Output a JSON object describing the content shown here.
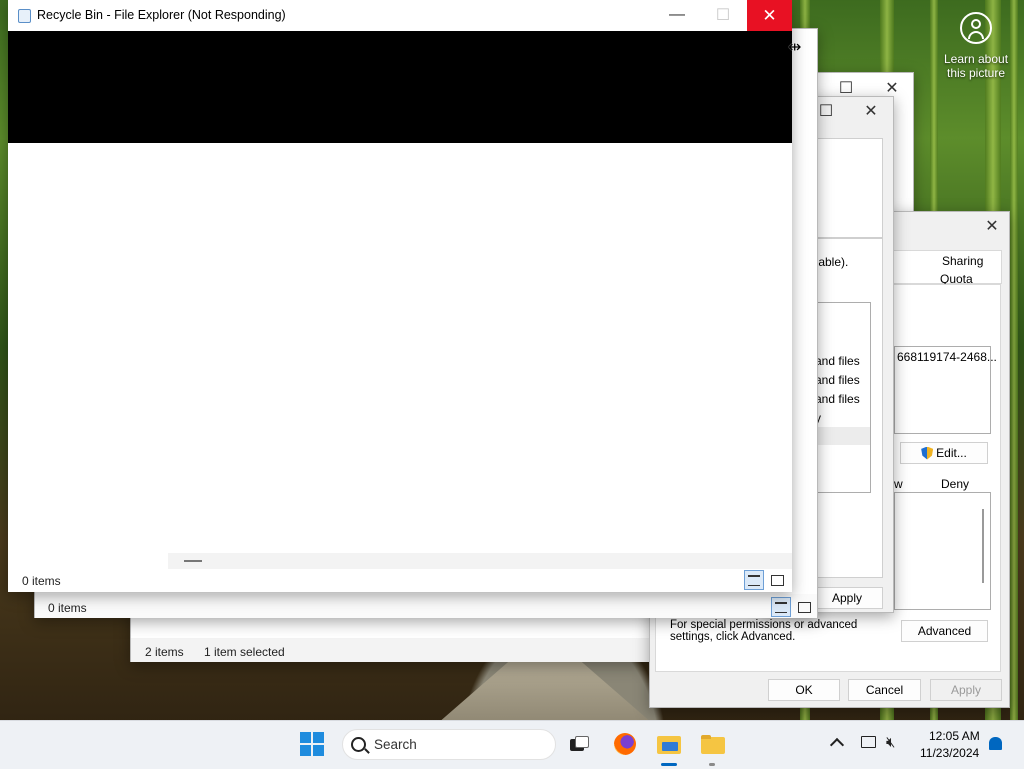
{
  "wallpaper": {
    "learn_line1": "Learn about",
    "learn_line2": "this picture"
  },
  "explorer_main": {
    "title": "Recycle Bin - File Explorer (Not Responding)",
    "status": "0 items"
  },
  "explorer_second": {
    "status": "0 items"
  },
  "explorer_third": {
    "status_items": "2 items",
    "status_selected": "1 item selected"
  },
  "dialog_behind": {
    "text_available": "ilable).",
    "perm_lines": [
      "and files",
      "and files",
      "and files",
      "y"
    ],
    "apply_label": "Apply"
  },
  "security_dialog": {
    "tabs": [
      "Sharing",
      "Quota"
    ],
    "sid_text": "668119174-2468...",
    "edit_label": "Edit...",
    "col_allow": "w",
    "col_deny": "Deny",
    "advanced_note": "For special permissions or advanced settings, click Advanced.",
    "advanced_label": "Advanced",
    "ok_label": "OK",
    "cancel_label": "Cancel",
    "apply_label": "Apply"
  },
  "taskbar": {
    "search_placeholder": "Search",
    "time": "12:05 AM",
    "date": "11/23/2024"
  },
  "colors": {
    "close_red": "#e81123",
    "accent": "#0067c0",
    "start_blue": "#1f8cde"
  }
}
